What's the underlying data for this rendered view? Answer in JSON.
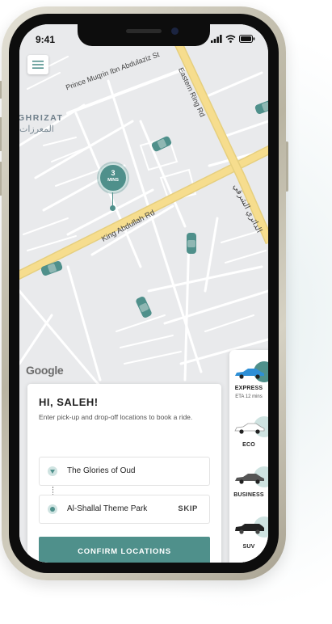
{
  "status_bar": {
    "time": "9:41"
  },
  "map": {
    "road_labels": {
      "prince_muqrin": "Prince Muqrin Ibn Abdulaziz St",
      "eastern_ring": "Eastern Ring Rd",
      "king_abdullah": "King Abdullah Rd",
      "arabic_road": "الدائري الشرقي"
    },
    "district_label": "GHRIZAT",
    "district_label_ar": "المعرزات",
    "attribution": "Google",
    "eta_marker": {
      "number": "3",
      "unit": "MINS"
    }
  },
  "booking": {
    "greeting": "HI, SALEH!",
    "instructions": "Enter pick-up and drop-off locations to book a ride.",
    "pickup": "The Glories of Oud",
    "dropoff": "Al-Shallal Theme Park",
    "skip_label": "SKIP",
    "confirm_label": "CONFIRM LOCATIONS"
  },
  "ride_options": [
    {
      "label": "EXPRESS",
      "subtitle": "ETA 12 mins",
      "selected": true,
      "car_color": "#2e8fd6"
    },
    {
      "label": "ECO",
      "selected": false,
      "car_color": "#ffffff"
    },
    {
      "label": "BUSINESS",
      "selected": false,
      "car_color": "#555555"
    },
    {
      "label": "SUV",
      "selected": false,
      "car_color": "#222222"
    }
  ],
  "colors": {
    "accent": "#4f908b",
    "accent_light": "#cfe3e1",
    "highway": "#f6dd8e",
    "map_background": "#e9eaec"
  }
}
